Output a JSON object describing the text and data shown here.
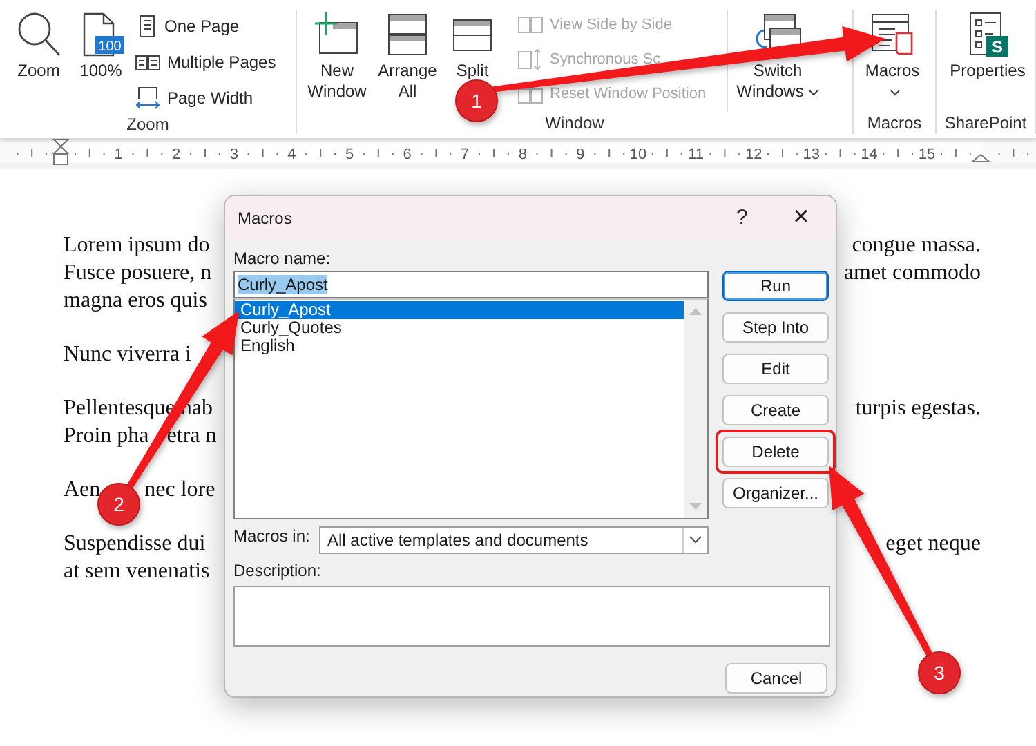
{
  "ribbon": {
    "groups": [
      {
        "label": "Zoom",
        "items": [
          {
            "kind": "large",
            "label": "Zoom",
            "dropdown": false
          },
          {
            "kind": "large",
            "label": "100%",
            "badge": "100",
            "dropdown": false
          },
          {
            "kind": "stack",
            "items": [
              {
                "label": "One Page",
                "disabled": false
              },
              {
                "label": "Multiple Pages",
                "disabled": false
              },
              {
                "label": "Page Width",
                "disabled": false
              }
            ]
          }
        ]
      },
      {
        "label": "Window",
        "items": [
          {
            "kind": "large",
            "label": "New Window",
            "dropdown": false
          },
          {
            "kind": "large",
            "label": "Arrange All",
            "dropdown": false
          },
          {
            "kind": "large",
            "label": "Split",
            "dropdown": false
          },
          {
            "kind": "stack",
            "items": [
              {
                "label": "View Side by Side",
                "disabled": true
              },
              {
                "label": "Synchronous Sc",
                "disabled": true
              },
              {
                "label": "Reset Window Position",
                "disabled": true
              }
            ]
          },
          {
            "kind": "large",
            "label": "Switch Windows",
            "dropdown": true
          }
        ]
      },
      {
        "label": "Macros",
        "items": [
          {
            "kind": "large",
            "label": "Macros",
            "dropdown": true
          }
        ]
      },
      {
        "label": "SharePoint",
        "items": [
          {
            "kind": "large",
            "label": "Properties",
            "badge": "S",
            "dropdown": false
          }
        ]
      }
    ]
  },
  "ruler": {
    "numbers": [
      "1",
      "2",
      "3",
      "4",
      "5",
      "6",
      "7",
      "8",
      "9",
      "10",
      "11",
      "12",
      "13",
      "14",
      "15"
    ]
  },
  "document": {
    "paragraphs": [
      {
        "lines": [
          {
            "left": "Lorem ipsum do",
            "right": "congue massa."
          },
          {
            "left": "Fusce posuere, n",
            "right": "amet commodo"
          },
          {
            "left": "magna eros quis"
          }
        ]
      },
      {
        "lines": [
          {
            "left": "Nunc viverra i"
          }
        ]
      },
      {
        "lines": [
          {
            "left": "Pellentesque hab",
            "right": "turpis egestas."
          },
          {
            "left": "Proin pha",
            "after_arrow": "etra n"
          }
        ]
      },
      {
        "lines": [
          {
            "left": "Aen",
            "after_arrow": "nec lore"
          }
        ]
      },
      {
        "lines": [
          {
            "left": "Suspendisse dui",
            "right": "eget neque"
          },
          {
            "left": "at sem venenatis"
          }
        ]
      }
    ]
  },
  "dialog": {
    "title": "Macros",
    "help": "?",
    "close": "×",
    "macro_name": {
      "label": "Macro name:",
      "value": "Curly_Apost",
      "text_selected": true
    },
    "macros": [
      {
        "name": "Curly_Apost",
        "selected": true
      },
      {
        "name": "Curly_Quotes",
        "selected": false
      },
      {
        "name": "English",
        "selected": false
      }
    ],
    "buttons": [
      {
        "label": "Run",
        "default": true,
        "highlighted": false
      },
      {
        "label": "Step Into",
        "default": false,
        "highlighted": false
      },
      {
        "label": "Edit",
        "default": false,
        "highlighted": false
      },
      {
        "label": "Create",
        "default": false,
        "highlighted": false
      },
      {
        "label": "Delete",
        "default": false,
        "highlighted": true
      },
      {
        "label": "Organizer...",
        "default": false,
        "highlighted": false
      }
    ],
    "macros_in": {
      "label": "Macros in:",
      "value": "All active templates and documents"
    },
    "description": {
      "label": "Description:"
    },
    "cancel": "Cancel"
  },
  "callouts": [
    {
      "number": "1"
    },
    {
      "number": "2"
    },
    {
      "number": "3"
    }
  ]
}
